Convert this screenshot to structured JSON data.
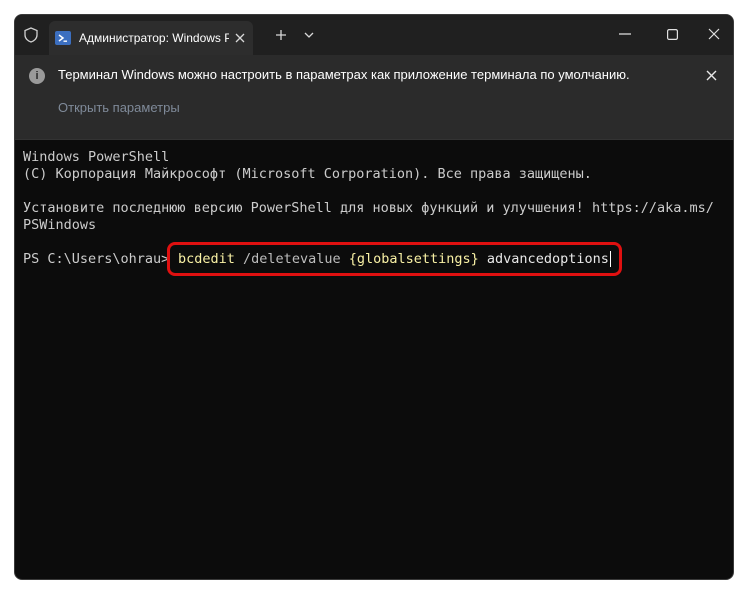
{
  "window": {
    "tab_title": "Администратор: Windows Pc"
  },
  "infobar": {
    "message": "Терминал Windows можно настроить в параметрах как приложение терминала по умолчанию.",
    "link": "Открыть параметры"
  },
  "terminal": {
    "lines": [
      "Windows PowerShell",
      "(C) Корпорация Майкрософт (Microsoft Corporation). Все права защищены.",
      "Установите последнюю версию PowerShell для новых функций и улучшения! https://aka.ms/",
      "PSWindows"
    ],
    "prompt": "PS C:\\Users\\ohrau>",
    "command": {
      "cmd": "bcdedit",
      "param": "/deletevalue",
      "arg": "{globalsettings}",
      "rest": "advancedoptions"
    }
  },
  "colors": {
    "terminal_bg": "#0c0c0c",
    "titlebar_bg": "#202020",
    "highlight_border": "#e01010",
    "command_yellow": "#f9f1a5"
  },
  "icons": {
    "shield": "shield-icon",
    "powershell": "powershell-icon",
    "close": "close-icon",
    "plus": "plus-icon",
    "chevron_down": "chevron-down-icon",
    "minimize": "minimize-icon",
    "maximize": "maximize-icon",
    "info": "info-icon"
  }
}
